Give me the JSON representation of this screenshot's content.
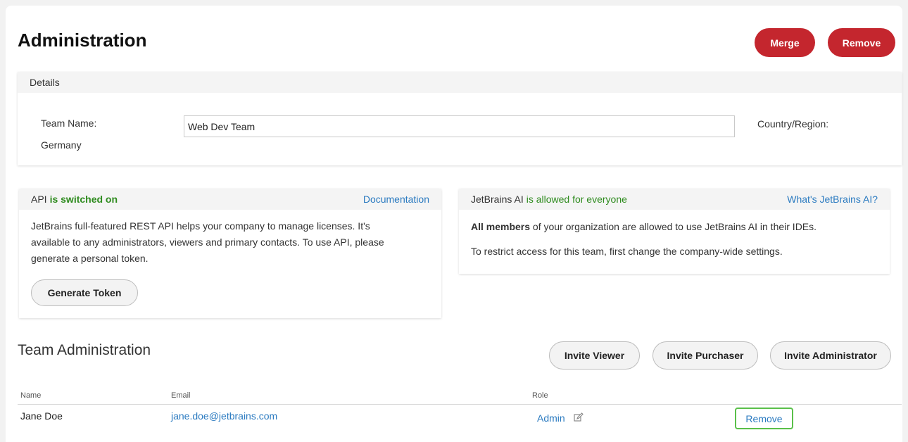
{
  "page": {
    "title": "Administration"
  },
  "header_actions": {
    "merge_label": "Merge",
    "remove_label": "Remove"
  },
  "details": {
    "header": "Details",
    "team_name_label": "Team Name:",
    "team_name_value": "Web Dev Team",
    "country_label": "Country/Region:",
    "country_value": "Germany"
  },
  "api": {
    "title_prefix": "API",
    "status": "is switched on",
    "doc_link": "Documentation",
    "line1": "JetBrains full-featured REST API helps your company to manage licenses. It's",
    "line2": "available to any administrators, viewers and primary contacts. To use API, please",
    "line3": "generate a personal token.",
    "token_button": "Generate Token"
  },
  "ai": {
    "title_prefix": "JetBrains AI",
    "status": "is allowed for everyone",
    "link": "What's JetBrains AI?",
    "bold": "All members",
    "line1_rest": " of your organization are allowed to use JetBrains AI in their IDEs.",
    "line2": "To restrict access for this team, first change the company-wide settings."
  },
  "team_admin": {
    "title": "Team Administration",
    "invite_viewer": "Invite Viewer",
    "invite_purchaser": "Invite Purchaser",
    "invite_admin": "Invite Administrator",
    "columns": {
      "name": "Name",
      "email": "Email",
      "role": "Role"
    },
    "rows": [
      {
        "name": "Jane Doe",
        "email": "jane.doe@jetbrains.com",
        "role": "Admin",
        "action": "Remove"
      }
    ]
  },
  "colors": {
    "accent_red": "#c4262e",
    "link_blue": "#2a7ac0",
    "status_green": "#2e8b1e",
    "focus_green": "#5ac04a"
  }
}
